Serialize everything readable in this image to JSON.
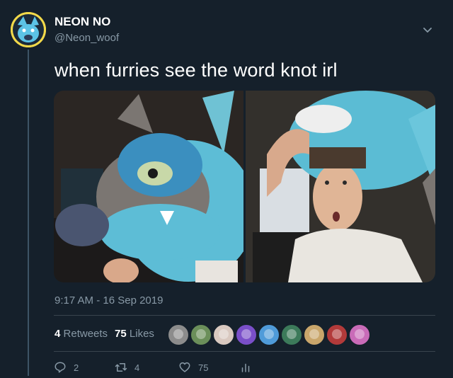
{
  "user": {
    "display_name": "NEON NO",
    "handle": "@Neon_woof",
    "avatar_icon": "blue-wolf-avatar"
  },
  "tweet": {
    "text": "when furries see the word knot irl",
    "timestamp": "9:17 AM - 16 Sep 2019",
    "media": [
      {
        "icon": "blue-fursuit-head-photo"
      },
      {
        "icon": "man-wearing-fursuit-hood-photo"
      }
    ]
  },
  "stats": {
    "retweets_count": "4",
    "retweets_label": "Retweets",
    "likes_count": "75",
    "likes_label": "Likes"
  },
  "likers": [
    {
      "color": "#8c8c8c"
    },
    {
      "color": "#6b8f5a"
    },
    {
      "color": "#d9c9c0"
    },
    {
      "color": "#7a4fc9"
    },
    {
      "color": "#4f9bd9"
    },
    {
      "color": "#3c7a5a"
    },
    {
      "color": "#c9a66b"
    },
    {
      "color": "#b23a3a"
    },
    {
      "color": "#c96bb8"
    }
  ],
  "actions": {
    "reply_count": "2",
    "retweet_count": "4",
    "like_count": "75"
  },
  "colors": {
    "background": "#15202b",
    "secondary_text": "#8899a6",
    "divider": "#38444d"
  }
}
